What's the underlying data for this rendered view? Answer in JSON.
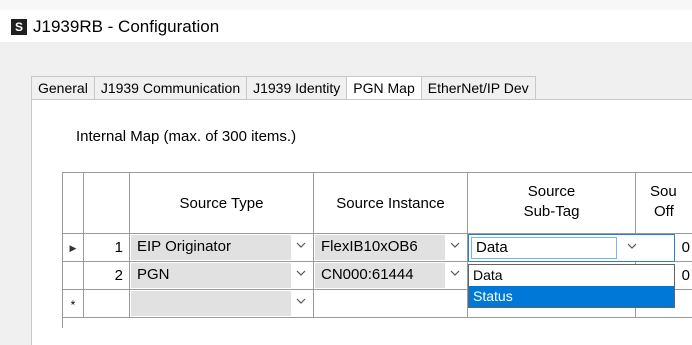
{
  "window": {
    "title": "J1939RB - Configuration",
    "icon": "app-s-icon"
  },
  "tabs": [
    {
      "label": "General"
    },
    {
      "label": "J1939 Communication"
    },
    {
      "label": "J1939 Identity"
    },
    {
      "label": "PGN Map",
      "active": true
    },
    {
      "label": "EtherNet/IP Dev"
    }
  ],
  "map": {
    "caption": "Internal Map (max. of 300 items.)",
    "columns": {
      "source_type": "Source Type",
      "source_instance": "Source Instance",
      "source_subtag_line1": "Source",
      "source_subtag_line2": "Sub-Tag",
      "source_offset_line1": "Sou",
      "source_offset_line2": "Off"
    },
    "rows": [
      {
        "num": "1",
        "indicator": "▶",
        "source_type": "EIP Originator",
        "source_instance": "FlexIB10xOB6",
        "subtag": "Data",
        "offset": "0"
      },
      {
        "num": "2",
        "indicator": "",
        "source_type": "PGN",
        "source_instance": "CN000:61444",
        "subtag": "",
        "offset": "0"
      },
      {
        "num": "",
        "indicator": "*",
        "source_type": "",
        "source_instance": "",
        "subtag": "",
        "offset": ""
      }
    ]
  },
  "subtag_dropdown": {
    "options": [
      {
        "label": "Data"
      },
      {
        "label": "Status",
        "highlighted": true
      }
    ]
  }
}
